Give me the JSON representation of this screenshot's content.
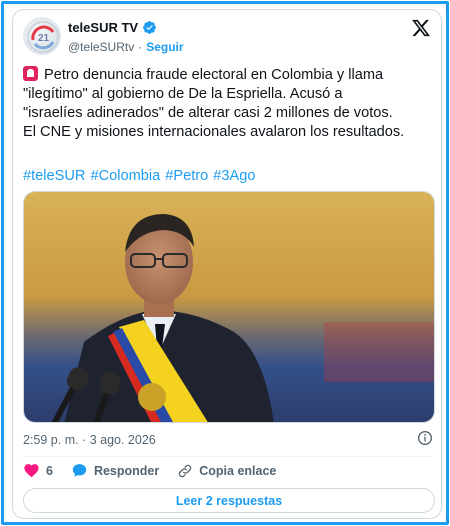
{
  "author": {
    "name": "teleSUR TV",
    "handle": "@teleSURtv",
    "separator": "·",
    "follow_label": "Seguir"
  },
  "tweet": {
    "line1": "Petro denuncia fraude electoral en Colombia y llama",
    "line2": "\"ilegítimo\" al gobierno de De la Espriella. Acusó a",
    "line3": "\"israelíes adinerados\" de alterar casi 2 millones de votos.",
    "line4": "El CNE y misiones internacionales avalaron los resultados.",
    "hashtags": [
      "#teleSUR",
      "#Colombia",
      "#Petro",
      "#3Ago"
    ]
  },
  "meta": {
    "timestamp": "2:59 p. m. · 3 ago. 2026"
  },
  "actions": {
    "like_count": "6",
    "reply_label": "Responder",
    "copy_label": "Copia enlace"
  },
  "read_replies_label": "Leer 2 respuestas",
  "colors": {
    "accent": "#1d9bf0",
    "like": "#f91880",
    "frame": "#1d9bf0"
  }
}
